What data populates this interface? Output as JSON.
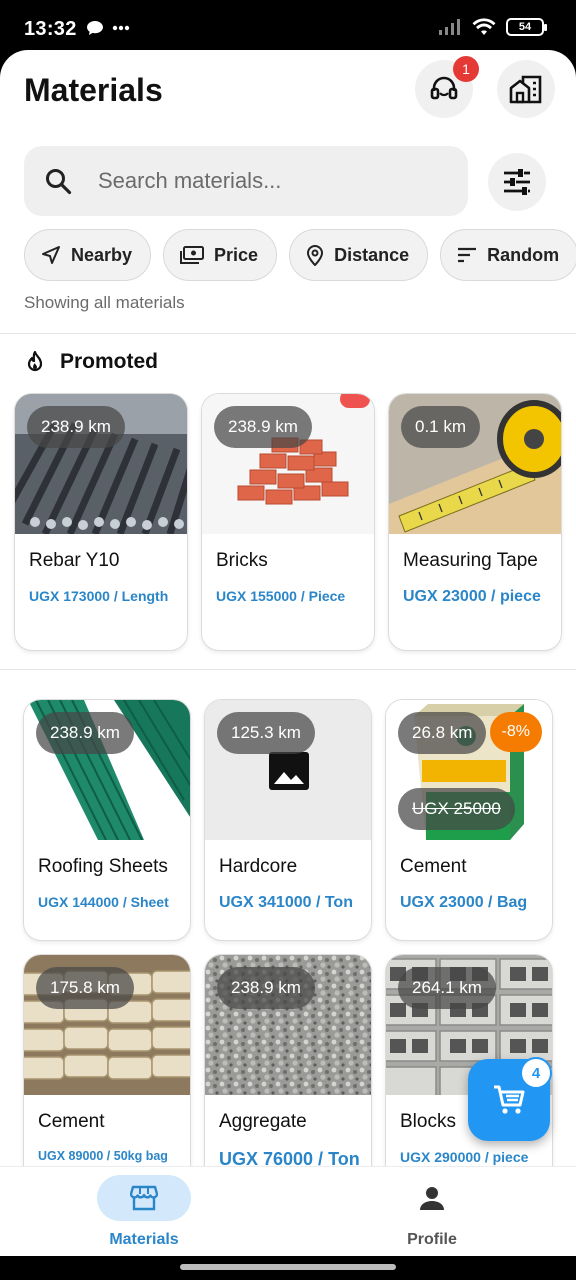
{
  "status_bar": {
    "time": "13:32",
    "battery": "54"
  },
  "header": {
    "title": "Materials",
    "support_badge": "1"
  },
  "search": {
    "placeholder": "Search materials..."
  },
  "filters": {
    "chips": [
      {
        "label": "Nearby",
        "icon": "navigation-arrow-icon"
      },
      {
        "label": "Price",
        "icon": "cash-icon"
      },
      {
        "label": "Distance",
        "icon": "location-pin-icon"
      },
      {
        "label": "Random",
        "icon": "sort-lines-icon"
      }
    ],
    "status": "Showing all materials"
  },
  "promoted": {
    "heading": "Promoted",
    "items": [
      {
        "distance": "238.9 km",
        "name": "Rebar Y10",
        "price": "UGX 173000 / Length"
      },
      {
        "distance": "238.9 km",
        "name": "Bricks",
        "price": "UGX 155000 / Piece"
      },
      {
        "distance": "0.1 km",
        "name": "Measuring Tape",
        "price": "UGX 23000 / piece"
      }
    ]
  },
  "materials": [
    {
      "distance": "238.9 km",
      "name": "Roofing Sheets",
      "price": "UGX 144000 / Sheet"
    },
    {
      "distance": "125.3 km",
      "name": "Hardcore",
      "price": "UGX 341000 / Ton"
    },
    {
      "distance": "26.8 km",
      "name": "Cement",
      "price": "UGX 23000 / Bag",
      "discount": "-8%",
      "old_price": "UGX 25000"
    },
    {
      "distance": "175.8 km",
      "name": "Cement",
      "price": "UGX 89000 / 50kg bag"
    },
    {
      "distance": "238.9 km",
      "name": "Aggregate",
      "price": "UGX 76000 / Ton"
    },
    {
      "distance": "264.1 km",
      "name": "Blocks",
      "price": "UGX 290000 / piece"
    }
  ],
  "cart": {
    "count": "4"
  },
  "bottom_nav": {
    "materials_label": "Materials",
    "profile_label": "Profile"
  },
  "colors": {
    "accent": "#2196f3",
    "price": "#2a86c9",
    "badge": "#e53935",
    "discount": "#f57c00"
  }
}
